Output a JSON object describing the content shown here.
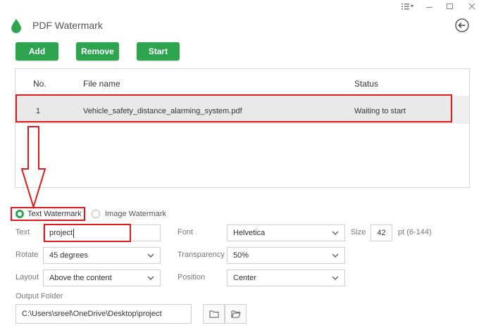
{
  "app": {
    "title": "PDF Watermark"
  },
  "window_controls": {
    "menu_icon": "menu-icon",
    "minimize": "minimize-icon",
    "maximize": "maximize-icon",
    "close": "close-icon"
  },
  "toolbar": {
    "add_label": "Add",
    "remove_label": "Remove",
    "start_label": "Start"
  },
  "table": {
    "headers": {
      "no": "No.",
      "file_name": "File name",
      "status": "Status"
    },
    "rows": [
      {
        "no": "1",
        "file_name": "Vehicle_safety_distance_alarming_system.pdf",
        "status": "Waiting to start"
      }
    ]
  },
  "watermark_type": {
    "text_label": "Text Watermark",
    "image_label": "Image Watermark",
    "selected": "text"
  },
  "settings": {
    "text_label": "Text",
    "text_value": "project",
    "font_label": "Font",
    "font_value": "Helvetica",
    "size_label": "Size",
    "size_value": "42",
    "size_range": "pt (6-144)",
    "rotate_label": "Rotate",
    "rotate_value": "45 degrees",
    "transparency_label": "Transparency",
    "transparency_value": "50%",
    "layout_label": "Layout",
    "layout_value": "Above the content",
    "position_label": "Position",
    "position_value": "Center"
  },
  "output": {
    "label": "Output Folder",
    "path": "C:\\Users\\sreel\\OneDrive\\Desktop\\project"
  },
  "colors": {
    "accent": "#2ea44f",
    "annotation": "#e01a1a"
  }
}
